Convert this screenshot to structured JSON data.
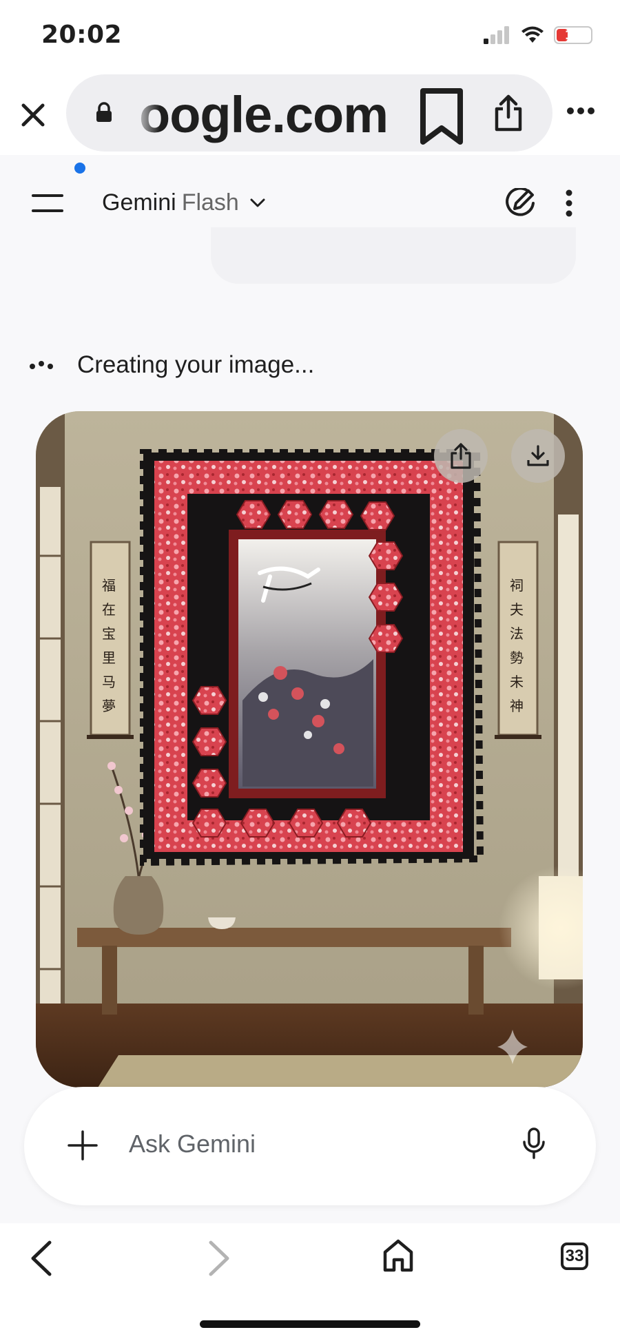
{
  "status_bar": {
    "time": "20:02",
    "battery": "15"
  },
  "browser": {
    "url": "oogle.com"
  },
  "app": {
    "name": "Gemini",
    "model": "Flash"
  },
  "chat": {
    "status": "Creating your image..."
  },
  "input": {
    "placeholder": "Ask Gemini"
  },
  "nav": {
    "tab_count": "33"
  },
  "colors": {
    "accent": "#1a73e8",
    "battery_low": "#e53935",
    "quilt_red": "#d8434f",
    "quilt_black": "#161414"
  },
  "icons": [
    "close-icon",
    "lock-icon",
    "bookmark-icon",
    "share-icon",
    "more-icon",
    "menu-icon",
    "chevron-down-icon",
    "edit-icon",
    "kebab-icon",
    "download-icon",
    "sparkle-icon",
    "plus-icon",
    "mic-icon",
    "back-icon",
    "forward-icon",
    "home-icon"
  ]
}
